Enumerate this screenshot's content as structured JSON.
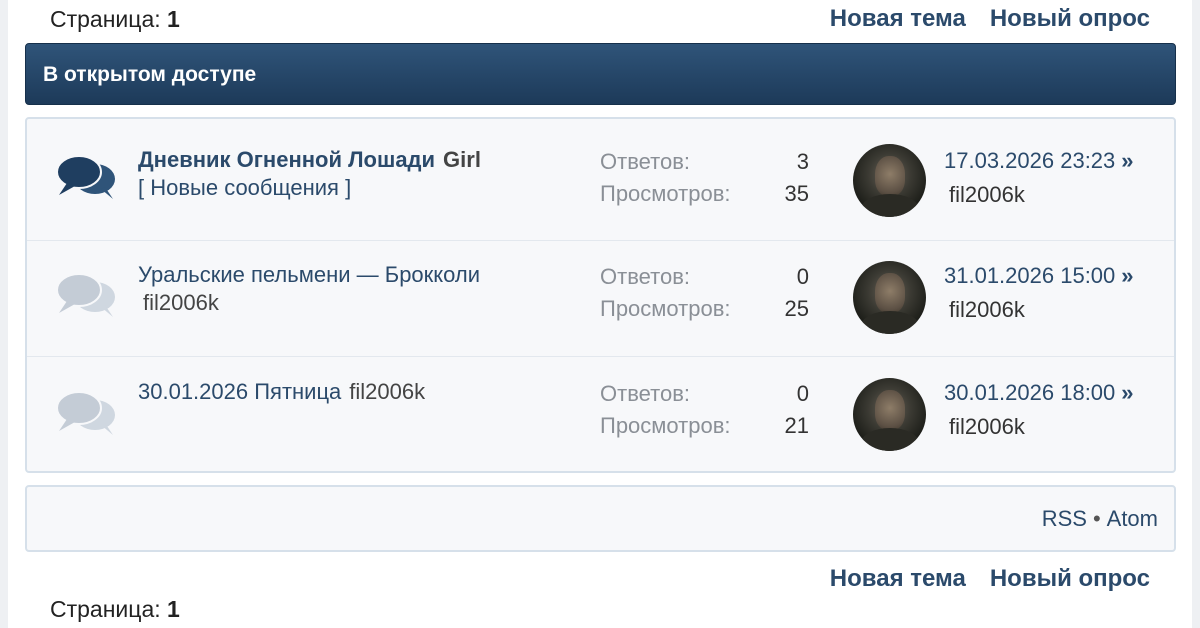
{
  "pager": {
    "label": "Страница:",
    "current": "1"
  },
  "actions": {
    "new_thread": "Новая тема",
    "new_poll": "Новый опрос"
  },
  "category": {
    "title": "В открытом доступе"
  },
  "labels": {
    "replies": "Ответов:",
    "views": "Просмотров:"
  },
  "threads": [
    {
      "title": "Дневник Огненной Лошади",
      "author": "Girl",
      "new_messages": "[ Новые сообщения ]",
      "replies": "3",
      "views": "35",
      "last_date": "17.03.2026 23:23",
      "last_user": "fil2006k",
      "unread": true
    },
    {
      "title": "Уральские пельмени — Брокколи",
      "author": "fil2006k",
      "replies": "0",
      "views": "25",
      "last_date": "31.01.2026 15:00",
      "last_user": "fil2006k",
      "unread": false
    },
    {
      "title": "30.01.2026 Пятница",
      "author": "fil2006k",
      "replies": "0",
      "views": "21",
      "last_date": "30.01.2026 18:00",
      "last_user": "fil2006k",
      "unread": false
    }
  ],
  "go_glyph": "»",
  "feeds": {
    "rss": "RSS",
    "separator": "•",
    "atom": "Atom"
  },
  "icons": {
    "unread": "speech-bubbles-icon-dark",
    "read": "speech-bubbles-icon-light"
  },
  "colors": {
    "header_bg": "#1d3a59",
    "link": "#2b4a6b",
    "icon_unread": "#2f5479",
    "icon_read": "#c9d2dc"
  }
}
